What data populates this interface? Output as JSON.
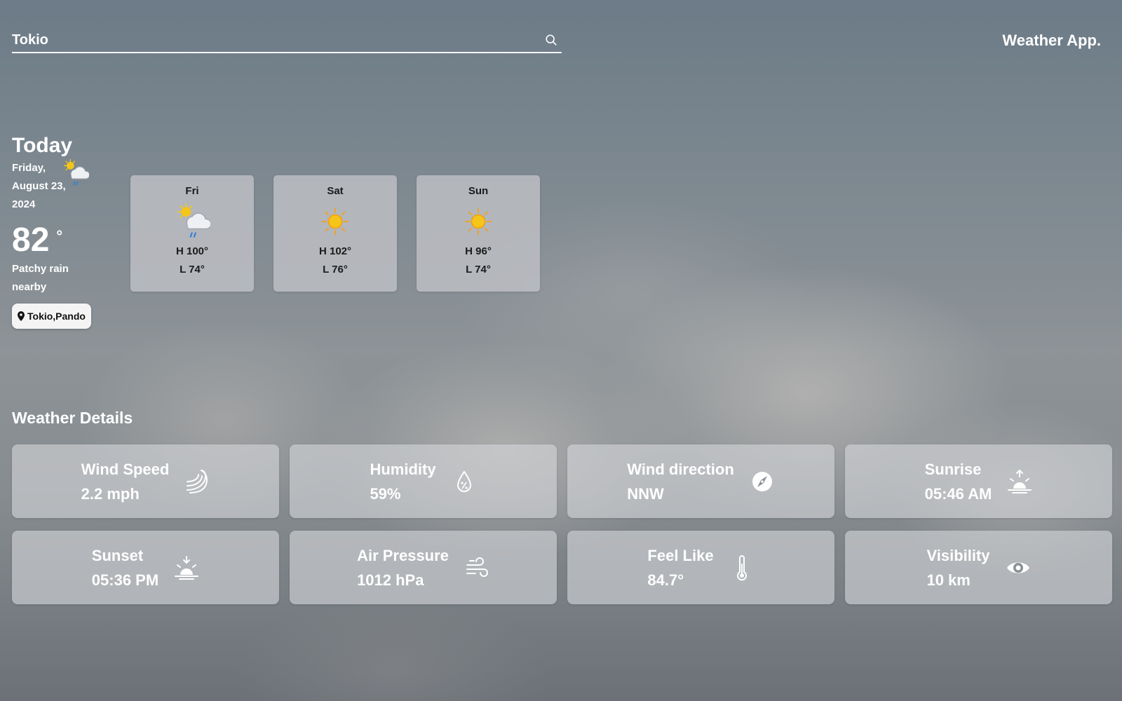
{
  "search": {
    "value": "Tokio",
    "placeholder": ""
  },
  "brand": "Weather App.",
  "today": {
    "title": "Today",
    "date": "Friday, August 23, 2024",
    "temp": "82",
    "degree": "°",
    "condition": "Patchy rain nearby",
    "icon": "patchy-rain-icon",
    "location": "Tokio,Pando"
  },
  "forecast": [
    {
      "day": "Fri",
      "high": "H 100°",
      "low": "L 74°",
      "icon": "patchy-rain-icon"
    },
    {
      "day": "Sat",
      "high": "H 102°",
      "low": "L 76°",
      "icon": "sunny-icon"
    },
    {
      "day": "Sun",
      "high": "H 96°",
      "low": "L 74°",
      "icon": "sunny-icon"
    }
  ],
  "details": {
    "title": "Weather Details",
    "items": [
      {
        "label": "Wind Speed",
        "value": "2.2 mph",
        "icon": "wind-speed-icon"
      },
      {
        "label": "Humidity",
        "value": "59%",
        "icon": "humidity-icon"
      },
      {
        "label": "Wind direction",
        "value": "NNW",
        "icon": "compass-icon"
      },
      {
        "label": "Sunrise",
        "value": "05:46 AM",
        "icon": "sunrise-icon"
      },
      {
        "label": "Sunset",
        "value": "05:36 PM",
        "icon": "sunset-icon"
      },
      {
        "label": "Air Pressure",
        "value": "1012 hPa",
        "icon": "air-pressure-icon"
      },
      {
        "label": "Feel Like",
        "value": "84.7°",
        "icon": "thermometer-icon"
      },
      {
        "label": "Visibility",
        "value": "10 km",
        "icon": "eye-icon"
      }
    ]
  },
  "colors": {
    "text": "#ffffff",
    "card_text": "#1b1b1b",
    "sun": "#f5c518",
    "rain": "#2d7fd6"
  }
}
